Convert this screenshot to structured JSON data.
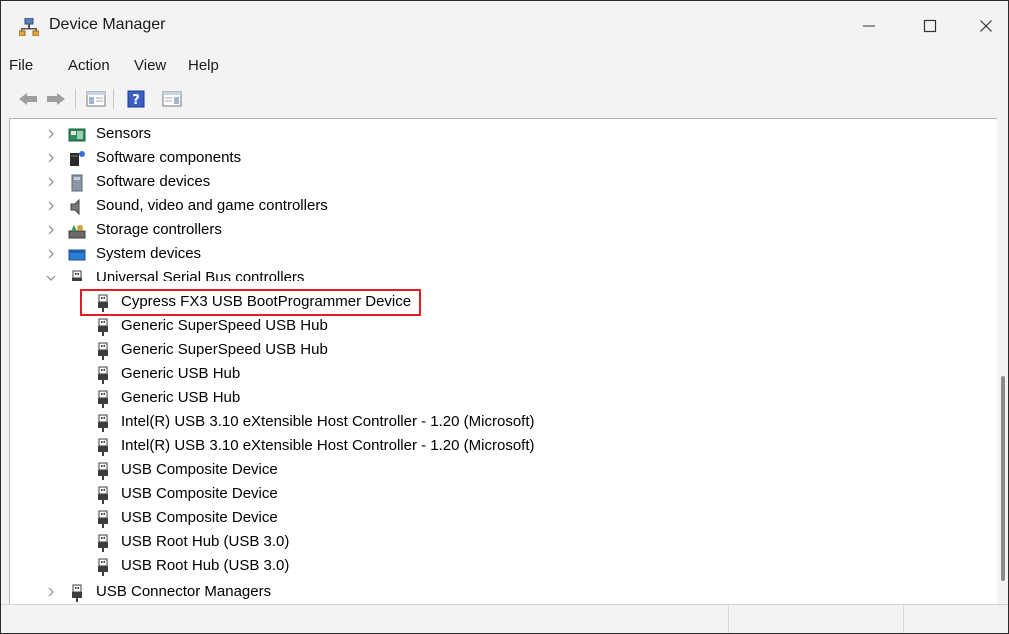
{
  "window": {
    "title": "Device Manager"
  },
  "menu": [
    "File",
    "Action",
    "View",
    "Help"
  ],
  "toolbar": {
    "buttons": [
      "back-icon",
      "forward-icon",
      "show-hide-console-tree-icon",
      "help-icon",
      "properties-icon"
    ]
  },
  "tree": {
    "categories_before": [
      {
        "label": "Sensors",
        "icon": "sensor-icon"
      },
      {
        "label": "Software components",
        "icon": "software-component-icon"
      },
      {
        "label": "Software devices",
        "icon": "software-device-icon"
      },
      {
        "label": "Sound, video and game controllers",
        "icon": "speaker-icon"
      },
      {
        "label": "Storage controllers",
        "icon": "storage-controller-icon"
      },
      {
        "label": "System devices",
        "icon": "system-device-icon"
      }
    ],
    "expanded": {
      "label": "Universal Serial Bus controllers",
      "icon": "usb-icon",
      "children": [
        "Cypress FX3 USB BootProgrammer Device",
        "Generic SuperSpeed USB Hub",
        "Generic SuperSpeed USB Hub",
        "Generic USB Hub",
        "Generic USB Hub",
        "Intel(R) USB 3.10 eXtensible Host Controller - 1.20 (Microsoft)",
        "Intel(R) USB 3.10 eXtensible Host Controller - 1.20 (Microsoft)",
        "USB Composite Device",
        "USB Composite Device",
        "USB Composite Device",
        "USB Root Hub (USB 3.0)",
        "USB Root Hub (USB 3.0)"
      ]
    },
    "categories_after": [
      {
        "label": "USB Connector Managers",
        "icon": "usb-icon"
      }
    ]
  },
  "highlight_color": "#e31b23"
}
